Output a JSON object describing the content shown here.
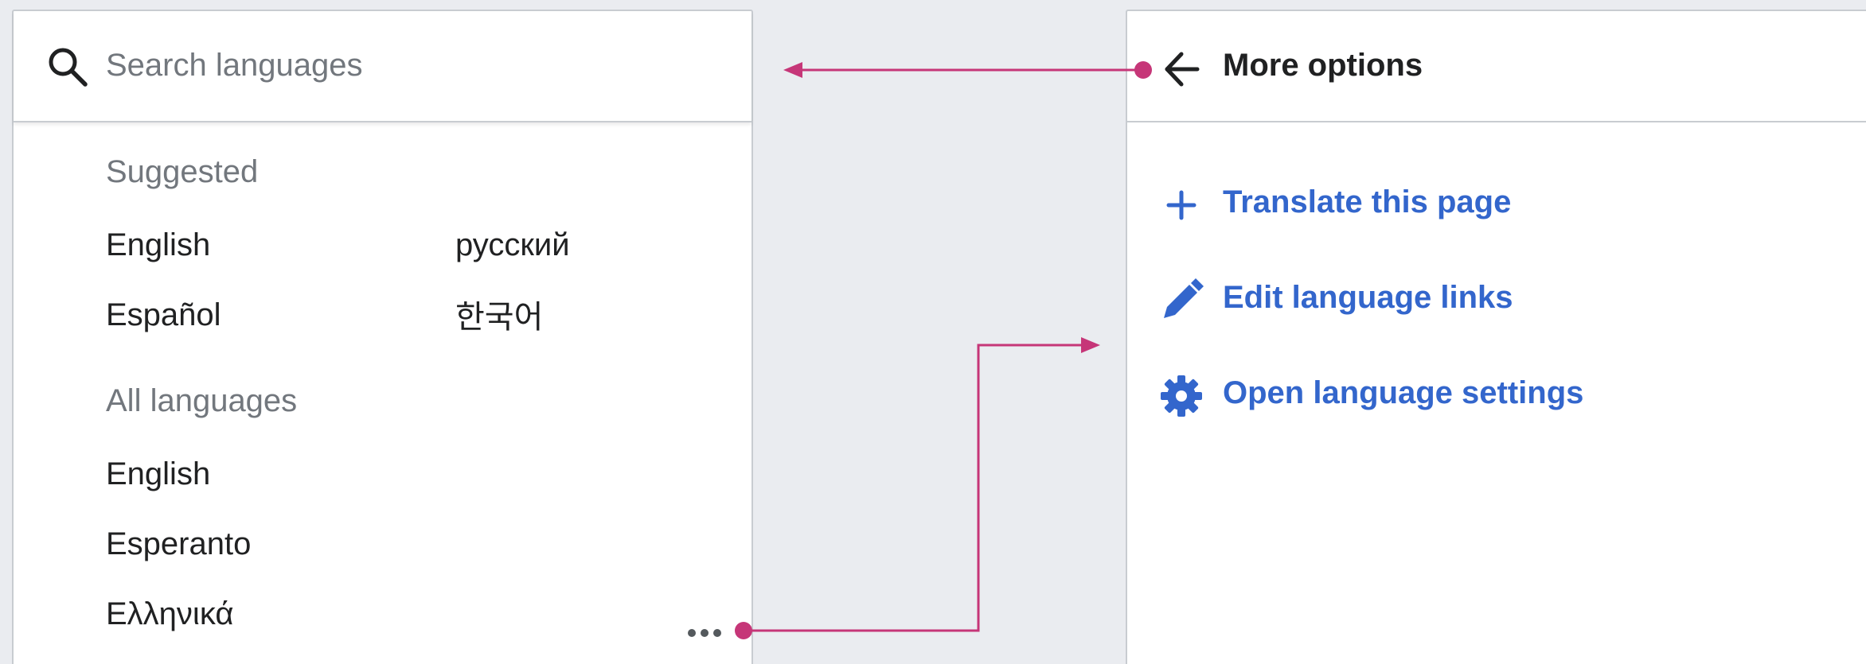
{
  "search": {
    "placeholder": "Search languages"
  },
  "suggested": {
    "heading": "Suggested",
    "languages": [
      "English",
      "русский",
      "Español",
      "한국어"
    ]
  },
  "all_languages": {
    "heading": "All languages",
    "languages": [
      "English",
      "Esperanto",
      "Ελληνικά"
    ]
  },
  "more_options": {
    "title": "More options",
    "items": [
      {
        "label": "Translate this page",
        "icon": "plus-icon"
      },
      {
        "label": "Edit language links",
        "icon": "pencil-icon"
      },
      {
        "label": "Open language settings",
        "icon": "gear-icon"
      }
    ]
  },
  "colors": {
    "background": "#eaecf0",
    "link_blue": "#3366cc",
    "connector_magenta": "#c63678",
    "muted_text": "#72777d",
    "body_text": "#202122"
  }
}
